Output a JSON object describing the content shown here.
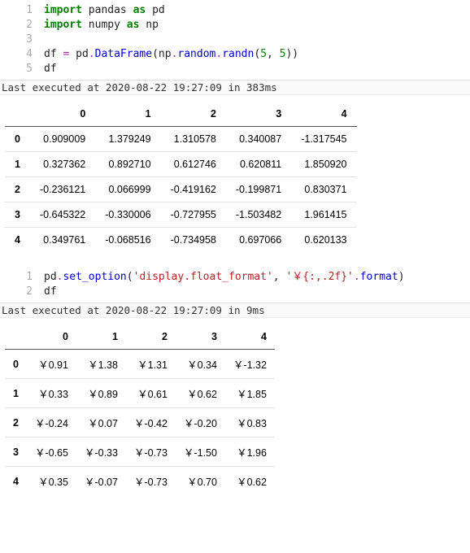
{
  "cell1": {
    "lines": {
      "n1": "1",
      "n2": "2",
      "n3": "3",
      "n4": "4",
      "n5": "5"
    },
    "kw_import1": "import",
    "pandas": " pandas ",
    "kw_as1": "as",
    "pd": " pd",
    "kw_import2": "import",
    "numpy": " numpy ",
    "kw_as2": "as",
    "np": " np",
    "df_lhs": "df ",
    "eq": "=",
    "pd_call": " pd",
    "dot1": ".",
    "DataFrame": "DataFrame",
    "lp1": "(",
    "np_call": "np",
    "dot2": ".",
    "random": "random",
    "dot3": ".",
    "randn": "randn",
    "lp2": "(",
    "five_a": "5",
    "comma": ", ",
    "five_b": "5",
    "rp": "))",
    "df_last": "df"
  },
  "exec1": "Last executed at 2020-08-22 19:27:09 in 383ms",
  "table1": {
    "cols": [
      "0",
      "1",
      "2",
      "3",
      "4"
    ],
    "rows": [
      "0",
      "1",
      "2",
      "3",
      "4"
    ],
    "data": [
      [
        "0.909009",
        "1.379249",
        "1.310578",
        "0.340087",
        "-1.317545"
      ],
      [
        "0.327362",
        "0.892710",
        "0.612746",
        "0.620811",
        "1.850920"
      ],
      [
        "-0.236121",
        "0.066999",
        "-0.419162",
        "-0.199871",
        "0.830371"
      ],
      [
        "-0.645322",
        "-0.330006",
        "-0.727955",
        "-1.503482",
        "1.961415"
      ],
      [
        "0.349761",
        "-0.068516",
        "-0.734958",
        "0.697066",
        "0.620133"
      ]
    ]
  },
  "cell2": {
    "n1": "1",
    "n2": "2",
    "pd": "pd",
    "dot": ".",
    "set_option": "set_option",
    "lp": "(",
    "arg1": "'display.float_format'",
    "comma": ", ",
    "arg2": "'￥{:,.2f}'",
    "dot2": ".",
    "format": "format",
    "rp": ")",
    "df": "df"
  },
  "exec2": "Last executed at 2020-08-22 19:27:09 in 9ms",
  "table2": {
    "cols": [
      "0",
      "1",
      "2",
      "3",
      "4"
    ],
    "rows": [
      "0",
      "1",
      "2",
      "3",
      "4"
    ],
    "data": [
      [
        "￥0.91",
        "￥1.38",
        "￥1.31",
        "￥0.34",
        "￥-1.32"
      ],
      [
        "￥0.33",
        "￥0.89",
        "￥0.61",
        "￥0.62",
        "￥1.85"
      ],
      [
        "￥-0.24",
        "￥0.07",
        "￥-0.42",
        "￥-0.20",
        "￥0.83"
      ],
      [
        "￥-0.65",
        "￥-0.33",
        "￥-0.73",
        "￥-1.50",
        "￥1.96"
      ],
      [
        "￥0.35",
        "￥-0.07",
        "￥-0.73",
        "￥0.70",
        "￥0.62"
      ]
    ]
  },
  "chart_data": [
    {
      "type": "table",
      "title": "DataFrame output (default float format)",
      "columns": [
        "0",
        "1",
        "2",
        "3",
        "4"
      ],
      "index": [
        "0",
        "1",
        "2",
        "3",
        "4"
      ],
      "values": [
        [
          0.909009,
          1.379249,
          1.310578,
          0.340087,
          -1.317545
        ],
        [
          0.327362,
          0.89271,
          0.612746,
          0.620811,
          1.85092
        ],
        [
          -0.236121,
          0.066999,
          -0.419162,
          -0.199871,
          0.830371
        ],
        [
          -0.645322,
          -0.330006,
          -0.727955,
          -1.503482,
          1.961415
        ],
        [
          0.349761,
          -0.068516,
          -0.734958,
          0.697066,
          0.620133
        ]
      ]
    },
    {
      "type": "table",
      "title": "DataFrame output (￥{:,.2f} float format)",
      "columns": [
        "0",
        "1",
        "2",
        "3",
        "4"
      ],
      "index": [
        "0",
        "1",
        "2",
        "3",
        "4"
      ],
      "values": [
        [
          "￥0.91",
          "￥1.38",
          "￥1.31",
          "￥0.34",
          "￥-1.32"
        ],
        [
          "￥0.33",
          "￥0.89",
          "￥0.61",
          "￥0.62",
          "￥1.85"
        ],
        [
          "￥-0.24",
          "￥0.07",
          "￥-0.42",
          "￥-0.20",
          "￥0.83"
        ],
        [
          "￥-0.65",
          "￥-0.33",
          "￥-0.73",
          "￥-1.50",
          "￥1.96"
        ],
        [
          "￥0.35",
          "￥-0.07",
          "￥-0.73",
          "￥0.70",
          "￥0.62"
        ]
      ]
    }
  ]
}
